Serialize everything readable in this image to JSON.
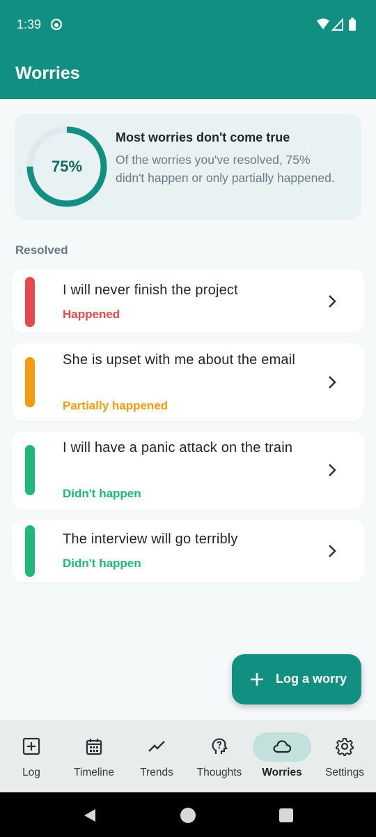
{
  "status_bar": {
    "time": "1:39"
  },
  "app_bar": {
    "title": "Worries"
  },
  "summary": {
    "percent": 75,
    "percent_label": "75%",
    "title": "Most worries don't come true",
    "body": "Of the worries you've resolved, 75% didn't happen or only partially happened."
  },
  "section": {
    "label": "Resolved"
  },
  "worries": [
    {
      "text": "I will never finish the project",
      "status": "Happened",
      "color": "#e5484d"
    },
    {
      "text": "She is upset with me about the email",
      "status": "Partially happened",
      "color": "#f39c12"
    },
    {
      "text": "I will have a panic attack on the train",
      "status": "Didn't happen",
      "color": "#1fb87a"
    },
    {
      "text": "The interview will go terribly",
      "status": "Didn't happen",
      "color": "#1fb87a"
    }
  ],
  "fab": {
    "label": "Log a worry",
    "icon": "plus-icon"
  },
  "nav": {
    "active": "Worries",
    "items": [
      {
        "label": "Log",
        "icon": "add-box-icon"
      },
      {
        "label": "Timeline",
        "icon": "calendar-icon"
      },
      {
        "label": "Trends",
        "icon": "trend-line-icon"
      },
      {
        "label": "Thoughts",
        "icon": "thought-head-icon"
      },
      {
        "label": "Worries",
        "icon": "cloud-icon"
      },
      {
        "label": "Settings",
        "icon": "gear-icon"
      }
    ]
  },
  "colors": {
    "primary": "#118f80",
    "ring_track": "#dfe8ec",
    "happened": "#e5484d",
    "partial": "#f39c12",
    "didnt_happen": "#1fb87a"
  }
}
